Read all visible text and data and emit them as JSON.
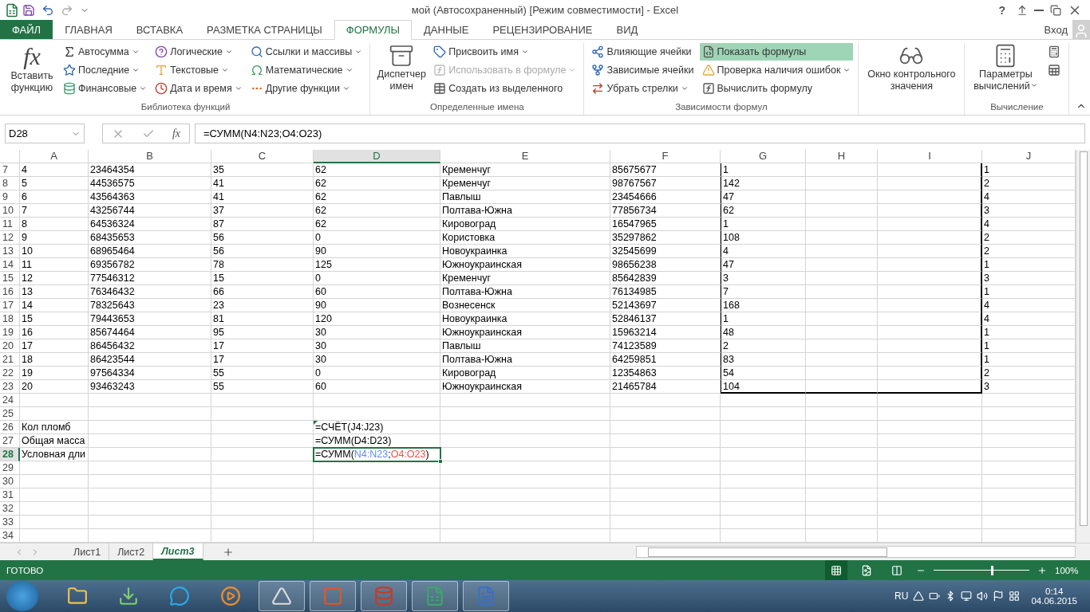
{
  "window": {
    "title": "мой (Автосохраненный)  [Режим совместимости] - Excel",
    "help": "?",
    "user": "Вход"
  },
  "tabs": [
    {
      "label": "ФАЙЛ",
      "kind": "file",
      "selected": false
    },
    {
      "label": "ГЛАВНАЯ",
      "kind": "tab",
      "selected": false
    },
    {
      "label": "ВСТАВКА",
      "kind": "tab",
      "selected": false
    },
    {
      "label": "РАЗМЕТКА СТРАНИЦЫ",
      "kind": "tab",
      "selected": false
    },
    {
      "label": "ФОРМУЛЫ",
      "kind": "tab",
      "selected": true
    },
    {
      "label": "ДАННЫЕ",
      "kind": "tab",
      "selected": false
    },
    {
      "label": "РЕЦЕНЗИРОВАНИЕ",
      "kind": "tab",
      "selected": false
    },
    {
      "label": "ВИД",
      "kind": "tab",
      "selected": false
    }
  ],
  "ribbon": {
    "groups": [
      {
        "label": "Библиотека функций",
        "big": [
          {
            "label": "Вставить функцию",
            "glyph": "fx",
            "dropdown": false
          }
        ],
        "columns": [
          [
            {
              "label": "Автосумма",
              "dropdown": true,
              "disabled": false,
              "selected": false
            },
            {
              "label": "Последние",
              "dropdown": true,
              "disabled": false,
              "selected": false
            },
            {
              "label": "Финансовые",
              "dropdown": true,
              "disabled": false,
              "selected": false
            }
          ],
          [
            {
              "label": "Логические",
              "dropdown": true,
              "disabled": false,
              "selected": false
            },
            {
              "label": "Текстовые",
              "dropdown": true,
              "disabled": false,
              "selected": false
            },
            {
              "label": "Дата и время",
              "dropdown": true,
              "disabled": false,
              "selected": false
            }
          ],
          [
            {
              "label": "Ссылки и массивы",
              "dropdown": true,
              "disabled": false,
              "selected": false
            },
            {
              "label": "Математические",
              "dropdown": true,
              "disabled": false,
              "selected": false
            },
            {
              "label": "Другие функции",
              "dropdown": true,
              "disabled": false,
              "selected": false
            }
          ]
        ]
      },
      {
        "label": "Определенные имена",
        "big": [
          {
            "label": "Диспетчер имен",
            "dropdown": false
          }
        ],
        "columns": [
          [
            {
              "label": "Присвоить имя",
              "dropdown": true,
              "disabled": false,
              "selected": false
            },
            {
              "label": "Использовать в формуле",
              "dropdown": true,
              "disabled": true,
              "selected": false
            },
            {
              "label": "Создать из выделенного",
              "dropdown": false,
              "disabled": false,
              "selected": false
            }
          ]
        ]
      },
      {
        "label": "Зависимости формул",
        "columns": [
          [
            {
              "label": "Влияющие ячейки",
              "dropdown": false,
              "disabled": false,
              "selected": false
            },
            {
              "label": "Зависимые ячейки",
              "dropdown": false,
              "disabled": false,
              "selected": false
            },
            {
              "label": "Убрать стрелки",
              "dropdown": true,
              "disabled": false,
              "selected": false
            }
          ],
          [
            {
              "label": "Показать формулы",
              "dropdown": false,
              "disabled": false,
              "selected": true
            },
            {
              "label": "Проверка наличия ошибок",
              "dropdown": true,
              "disabled": false,
              "selected": false
            },
            {
              "label": "Вычислить формулу",
              "dropdown": false,
              "disabled": false,
              "selected": false
            }
          ]
        ]
      },
      {
        "big": [
          {
            "label": "Окно контрольного значения",
            "dropdown": false
          }
        ]
      },
      {
        "label": "Вычисление",
        "big": [
          {
            "label": "Параметры вычислений",
            "dropdown": true
          }
        ]
      }
    ]
  },
  "formula_bar": {
    "name_box": "D28",
    "fx": "fx",
    "formula": "=СУММ(N4:N23;O4:O23)"
  },
  "columns": [
    {
      "label": "A",
      "selected": false
    },
    {
      "label": "B",
      "selected": false
    },
    {
      "label": "C",
      "selected": false
    },
    {
      "label": "D",
      "selected": true
    },
    {
      "label": "E",
      "selected": false
    },
    {
      "label": "F",
      "selected": false
    },
    {
      "label": "G",
      "selected": false
    },
    {
      "label": "H",
      "selected": false
    },
    {
      "label": "I",
      "selected": false
    },
    {
      "label": "J",
      "selected": false
    }
  ],
  "rows": [
    {
      "num": "7",
      "selected": false,
      "boxed": true,
      "cells": [
        "4",
        "23464354",
        "35",
        "62",
        "Кременчуг",
        "85675677",
        "1",
        null,
        null,
        "1"
      ]
    },
    {
      "num": "8",
      "selected": false,
      "boxed": true,
      "cells": [
        "5",
        "44536575",
        "41",
        "62",
        "Кременчуг",
        "98767567",
        "142",
        null,
        null,
        "2"
      ]
    },
    {
      "num": "9",
      "selected": false,
      "boxed": true,
      "cells": [
        "6",
        "43564363",
        "41",
        "62",
        "Павлыш",
        "23454666",
        "47",
        null,
        null,
        "4"
      ]
    },
    {
      "num": "10",
      "selected": false,
      "boxed": true,
      "cells": [
        "7",
        "43256744",
        "37",
        "62",
        "Полтава-Южна",
        "77856734",
        "62",
        null,
        null,
        "3"
      ]
    },
    {
      "num": "11",
      "selected": false,
      "boxed": true,
      "cells": [
        "8",
        "64536324",
        "87",
        "62",
        "Кировоград",
        "16547965",
        "1",
        null,
        null,
        "4"
      ]
    },
    {
      "num": "12",
      "selected": false,
      "boxed": true,
      "cells": [
        "9",
        "68435653",
        "56",
        "0",
        "Користовка",
        "35297862",
        "108",
        null,
        null,
        "2"
      ]
    },
    {
      "num": "13",
      "selected": false,
      "boxed": true,
      "cells": [
        "10",
        "68965464",
        "56",
        "90",
        "Новоукраинка",
        "32545699",
        "4",
        null,
        null,
        "2"
      ]
    },
    {
      "num": "14",
      "selected": false,
      "boxed": true,
      "cells": [
        "11",
        "69356782",
        "78",
        "125",
        "Южноукраинская",
        "98656238",
        "47",
        null,
        null,
        "1"
      ]
    },
    {
      "num": "15",
      "selected": false,
      "boxed": true,
      "cells": [
        "12",
        "77546312",
        "15",
        "0",
        "Кременчуг",
        "85642839",
        "3",
        null,
        null,
        "3"
      ]
    },
    {
      "num": "16",
      "selected": false,
      "boxed": true,
      "cells": [
        "13",
        "76346432",
        "66",
        "60",
        "Полтава-Южна",
        "76134985",
        "7",
        null,
        null,
        "1"
      ]
    },
    {
      "num": "17",
      "selected": false,
      "boxed": true,
      "cells": [
        "14",
        "78325643",
        "23",
        "90",
        "Вознесенск",
        "52143697",
        "168",
        null,
        null,
        "4"
      ]
    },
    {
      "num": "18",
      "selected": false,
      "boxed": true,
      "cells": [
        "15",
        "79443653",
        "81",
        "120",
        "Новоукраинка",
        "52846137",
        "1",
        null,
        null,
        "4"
      ]
    },
    {
      "num": "19",
      "selected": false,
      "boxed": true,
      "cells": [
        "16",
        "85674464",
        "95",
        "30",
        "Южноукраинская",
        "15963214",
        "48",
        null,
        null,
        "1"
      ]
    },
    {
      "num": "20",
      "selected": false,
      "boxed": true,
      "cells": [
        "17",
        "86456432",
        "17",
        "30",
        "Павлыш",
        "74123589",
        "2",
        null,
        null,
        "1"
      ]
    },
    {
      "num": "21",
      "selected": false,
      "boxed": true,
      "cells": [
        "18",
        "86423544",
        "17",
        "30",
        "Полтава-Южна",
        "64259851",
        "83",
        null,
        null,
        "1"
      ]
    },
    {
      "num": "22",
      "selected": false,
      "boxed": true,
      "cells": [
        "19",
        "97564334",
        "55",
        "0",
        "Кировоград",
        "12354863",
        "54",
        null,
        null,
        "2"
      ]
    },
    {
      "num": "23",
      "selected": false,
      "boxed": true,
      "cells": [
        "20",
        "93463243",
        "55",
        "60",
        "Южноукраинская",
        "21465784",
        "104",
        null,
        null,
        "3"
      ]
    },
    {
      "num": "24",
      "selected": false,
      "boxed": false
    },
    {
      "num": "25",
      "selected": false,
      "boxed": false
    },
    {
      "num": "26",
      "selected": false,
      "boxed": false,
      "cells": [
        "Кол пломб",
        null,
        null,
        {
          "text": "=СЧЁТ(J4:J23)",
          "error_flag": true
        }
      ]
    },
    {
      "num": "27",
      "selected": false,
      "boxed": false,
      "cells": [
        "Общая масса",
        null,
        null,
        {
          "text": "=СУММ(D4:D23)",
          "error_flag": false
        }
      ]
    },
    {
      "num": "28",
      "selected": true,
      "boxed": false,
      "cells": [
        "Условная дли",
        null,
        null,
        {
          "segments": [
            {
              "text": "=СУММ("
            },
            {
              "text": "N4:N23",
              "color": "#5b8ff0"
            },
            {
              "text": ";"
            },
            {
              "text": "O4:O23",
              "color": "#e8544e"
            },
            {
              "text": ")"
            }
          ]
        }
      ]
    },
    {
      "num": "29",
      "selected": false,
      "boxed": false
    },
    {
      "num": "30",
      "selected": false,
      "boxed": false
    },
    {
      "num": "31",
      "selected": false,
      "boxed": false
    },
    {
      "num": "32",
      "selected": false,
      "boxed": false
    },
    {
      "num": "33",
      "selected": false,
      "boxed": false
    },
    {
      "num": "34",
      "selected": false,
      "boxed": false
    }
  ],
  "sheets": [
    {
      "label": "Лист1",
      "selected": false
    },
    {
      "label": "Лист2",
      "selected": false
    },
    {
      "label": "Лист3",
      "selected": true
    }
  ],
  "status_bar": {
    "status": "ГОТОВО",
    "zoom": {
      "level": 0.6,
      "reading": "100%"
    }
  },
  "taskbar": {
    "language": "RU",
    "time": "0:14",
    "date": "04.06.2015"
  }
}
